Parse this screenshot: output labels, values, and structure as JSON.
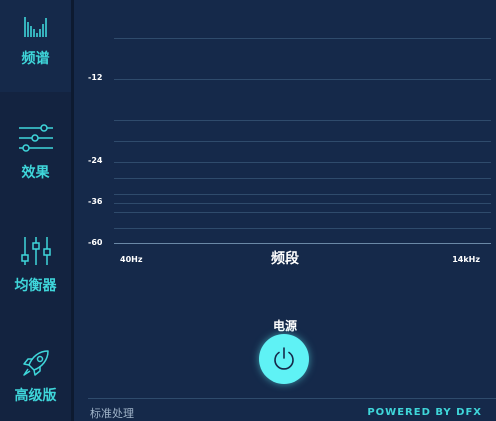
{
  "sidebar": {
    "items": [
      {
        "label": "频谱",
        "icon": "spectrum-icon",
        "active": true
      },
      {
        "label": "效果",
        "icon": "sliders-icon",
        "active": false
      },
      {
        "label": "均衡器",
        "icon": "equalizer-icon",
        "active": false
      },
      {
        "label": "高级版",
        "icon": "rocket-icon",
        "active": false
      }
    ]
  },
  "chart_data": {
    "type": "line",
    "y_ticks": [
      "-12",
      "-24",
      "-36",
      "-60"
    ],
    "x_tick_start": "40Hz",
    "x_tick_end": "14kHz",
    "xlabel": "频段",
    "grid": true
  },
  "power": {
    "label": "电源",
    "icon": "power-icon"
  },
  "footer": {
    "left_text": "标准处理",
    "right_text": "POWERED BY DFX"
  },
  "colors": {
    "accent": "#3fd6da",
    "power_button": "#5ff2f5",
    "background": "#15294a"
  }
}
